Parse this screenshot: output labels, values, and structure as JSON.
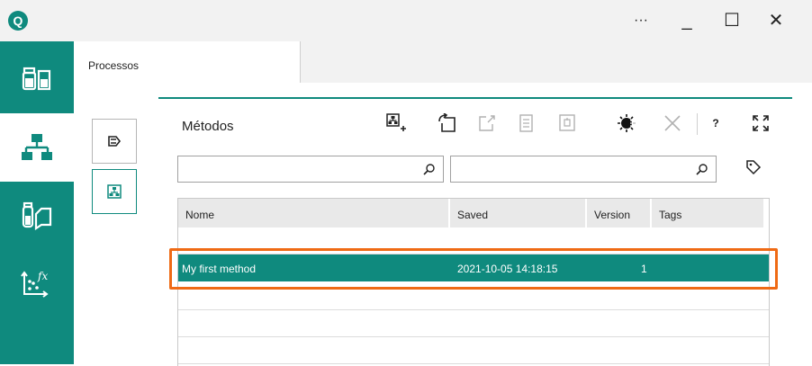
{
  "app": {
    "logo_letter": "Q"
  },
  "window_controls": {
    "more": "···",
    "minimize": "_",
    "maximize": "☐",
    "close": "✕"
  },
  "sidebar": {
    "items": [
      {
        "icon": "reagents-icon",
        "active": false
      },
      {
        "icon": "process-hierarchy-icon",
        "active": true
      },
      {
        "icon": "samples-icon",
        "active": false
      },
      {
        "icon": "function-plot-icon",
        "active": false
      }
    ]
  },
  "tab": {
    "label": "Processos"
  },
  "toolbox": {
    "items": [
      {
        "icon": "export-icon"
      },
      {
        "icon": "method-icon"
      }
    ]
  },
  "panel": {
    "title": "Métodos",
    "toolbar": [
      {
        "icon": "new-method-icon",
        "disabled": false
      },
      {
        "icon": "open-icon",
        "disabled": false
      },
      {
        "icon": "edit-icon",
        "disabled": true
      },
      {
        "icon": "document-icon",
        "disabled": true
      },
      {
        "icon": "copy-icon",
        "disabled": true
      },
      {
        "icon": "run-icon",
        "disabled": false
      },
      {
        "icon": "delete-icon",
        "disabled": true
      },
      {
        "icon": "help-icon",
        "label": "?",
        "disabled": false
      },
      {
        "icon": "expand-icon",
        "disabled": false
      }
    ]
  },
  "search": {
    "name_value": "",
    "name_placeholder": "",
    "tags_value": "",
    "tags_placeholder": ""
  },
  "table": {
    "columns": [
      "Nome",
      "Saved",
      "Version",
      "Tags"
    ],
    "rows": [
      {
        "name": "My first method",
        "saved": "2021-10-05 14:18:15",
        "version": "1",
        "tags": "",
        "selected": true
      }
    ]
  },
  "colors": {
    "accent": "#0f8a7e",
    "highlight": "#ef6a14",
    "header_bg": "#e9e9e9",
    "titlebar_bg": "#f2f2f2"
  }
}
